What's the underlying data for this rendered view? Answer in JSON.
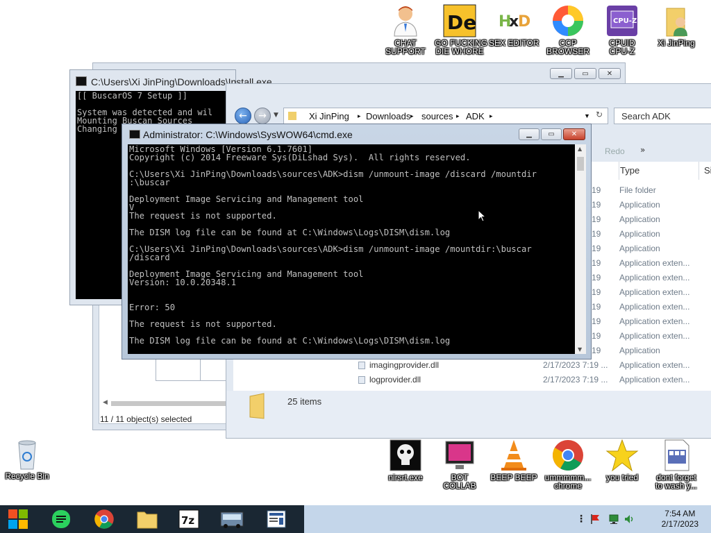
{
  "desktop_icons_top": [
    {
      "name": "chat-support",
      "label": "CHAT\nSUPPORT"
    },
    {
      "name": "go-fucking",
      "label": "GO FUCKING\nDIE WHORE"
    },
    {
      "name": "sex-editor",
      "label": "SEX EDITOR"
    },
    {
      "name": "ccp-browser",
      "label": "CCP\nBROWSER"
    },
    {
      "name": "cpuid-cpuz",
      "label": "CPUID\nCPU-Z"
    },
    {
      "name": "xi-jinping",
      "label": "Xi JinPing"
    }
  ],
  "desktop_icons_bottom": [
    {
      "name": "nirsoft",
      "label": "nirsrt.exe"
    },
    {
      "name": "bot-collab",
      "label": "BOT\nCOLLAB"
    },
    {
      "name": "beep-beep",
      "label": "BEEP BEEP"
    },
    {
      "name": "chrome",
      "label": "ummmmm...\nchrome"
    },
    {
      "name": "you-tried",
      "label": "you tried"
    },
    {
      "name": "dont-forget",
      "label": "dont forget\nto wash y..."
    }
  ],
  "recycle_bin": {
    "label": "Recycle Bin"
  },
  "install_window": {
    "title": "C:\\Users\\Xi JinPing\\Downloads\\Install.exe",
    "console": "[[ BuscarOS 7 Setup ]]\n\nSystem was detected and wil\nMounting Buscan Sources\nChanging"
  },
  "back_window": {
    "status": "11 / 11 object(s) selected"
  },
  "explorer": {
    "breadcrumbs": [
      "Xi JinPing",
      "Downloads",
      "sources",
      "ADK"
    ],
    "search_placeholder": "Search ADK",
    "redo": "Redo",
    "more": "»",
    "col_type": "Type",
    "col_size": "Siz",
    "rows": [
      {
        "name": "",
        "date": "19",
        "type": "File folder"
      },
      {
        "name": "",
        "date": "19",
        "type": "Application"
      },
      {
        "name": "",
        "date": "19",
        "type": "Application"
      },
      {
        "name": "",
        "date": "19",
        "type": "Application"
      },
      {
        "name": "",
        "date": "19",
        "type": "Application"
      },
      {
        "name": "",
        "date": "19",
        "type": "Application exten..."
      },
      {
        "name": "",
        "date": "19",
        "type": "Application exten..."
      },
      {
        "name": "",
        "date": "19",
        "type": "Application exten..."
      },
      {
        "name": "",
        "date": "19",
        "type": "Application exten..."
      },
      {
        "name": "",
        "date": "19",
        "type": "Application exten..."
      },
      {
        "name": "",
        "date": "19",
        "type": "Application exten..."
      },
      {
        "name": "",
        "date": "19",
        "type": "Application"
      },
      {
        "name": "imagingprovider.dll",
        "date": "2/17/2023 7:19 ...",
        "type": "Application exten..."
      },
      {
        "name": "logprovider.dll",
        "date": "2/17/2023 7:19 ...",
        "type": "Application exten..."
      }
    ],
    "item_count": "25 items"
  },
  "cmd": {
    "title": "Administrator: C:\\Windows\\SysWOW64\\cmd.exe",
    "output": "Microsoft Windows [Version 6.1.7601]\nCopyright (c) 2014 Freeware Sys(DiLshad Sys).  All rights reserved.\n\nC:\\Users\\Xi JinPing\\Downloads\\sources\\ADK>dism /unmount-image /discard /mountdir\n:\\buscar\n\nDeployment Image Servicing and Management tool\nV\nThe request is not supported.\n\nThe DISM log file can be found at C:\\Windows\\Logs\\DISM\\dism.log\n\nC:\\Users\\Xi JinPing\\Downloads\\sources\\ADK>dism /unmount-image /mountdir:\\buscar\n/discard\n\nDeployment Image Servicing and Management tool\nVersion: 10.0.20348.1\n\n\nError: 50\n\nThe request is not supported.\n\nThe DISM log file can be found at C:\\Windows\\Logs\\DISM\\dism.log"
  },
  "taskbar": {
    "items": [
      "start-button",
      "notes-app",
      "chrome-app",
      "file-explorer-app",
      "7zip-app",
      "bus-app",
      "document-app"
    ],
    "time": "7:54 AM",
    "date": "2/17/2023"
  },
  "colors": {
    "taskbar": "#1a2733",
    "console_bg": "#000000",
    "console_fg": "#c0c0c0"
  }
}
